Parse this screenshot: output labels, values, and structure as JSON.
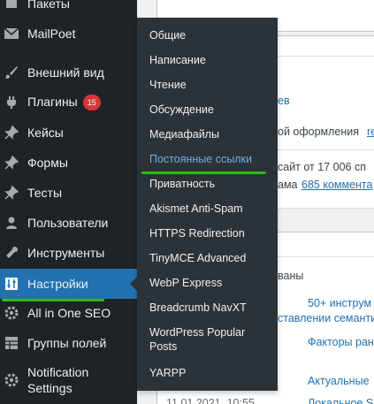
{
  "sidebar": {
    "items": [
      {
        "label": "Пакеты",
        "icon": "packages-icon"
      },
      {
        "label": "MailPoet",
        "icon": "email-icon"
      },
      {
        "label": "Внешний вид",
        "icon": "brush-icon"
      },
      {
        "label": "Плагины",
        "icon": "plugins-icon",
        "badge": "15"
      },
      {
        "label": "Кейсы",
        "icon": "pin-icon"
      },
      {
        "label": "Формы",
        "icon": "pin-icon"
      },
      {
        "label": "Тесты",
        "icon": "pin-icon"
      },
      {
        "label": "Пользователи",
        "icon": "user-icon"
      },
      {
        "label": "Инструменты",
        "icon": "wrench-icon"
      },
      {
        "label": "Настройки",
        "icon": "settings-icon",
        "active": true
      },
      {
        "label": "All in One SEO",
        "icon": "gear-icon"
      },
      {
        "label": "Группы полей",
        "icon": "grid-icon"
      },
      {
        "label": "Notification Settings",
        "icon": "gear-icon"
      }
    ]
  },
  "submenu": {
    "items": [
      {
        "label": "Общие"
      },
      {
        "label": "Написание"
      },
      {
        "label": "Чтение"
      },
      {
        "label": "Обсуждение"
      },
      {
        "label": "Медиафайлы"
      },
      {
        "label": "Постоянные ссылки",
        "current": true
      },
      {
        "label": "Приватность"
      },
      {
        "label": "Akismet Anti-Spam"
      },
      {
        "label": "HTTPS Redirection"
      },
      {
        "label": "TinyMCE Advanced"
      },
      {
        "label": "WebP Express"
      },
      {
        "label": "Breadcrumb NavXT"
      },
      {
        "label": "WordPress Popular Posts"
      },
      {
        "label": "YARPP"
      }
    ]
  },
  "content": {
    "frag_ev": "ев",
    "frag_theme": "ой оформления",
    "frag_theme_link": "re",
    "frag_site": "сайт от 17 006 сп",
    "frag_spam": "ама",
    "frag_comments_link": "685 коммента",
    "frag_vany": "ваны",
    "frag_50": "50+ инструм",
    "frag_semant": "ставлении семанти",
    "frag_factors": "Факторы ран",
    "frag_actual": "Актуальные",
    "frag_date": "11.01.2021, 10:55",
    "frag_local": "Локальное SE"
  },
  "colors": {
    "sidebar_bg": "#1d2327",
    "submenu_bg": "#2c3338",
    "active_bg": "#2271b1",
    "current_link": "#72aee6",
    "annotation": "#33b71a",
    "badge": "#d63638"
  }
}
